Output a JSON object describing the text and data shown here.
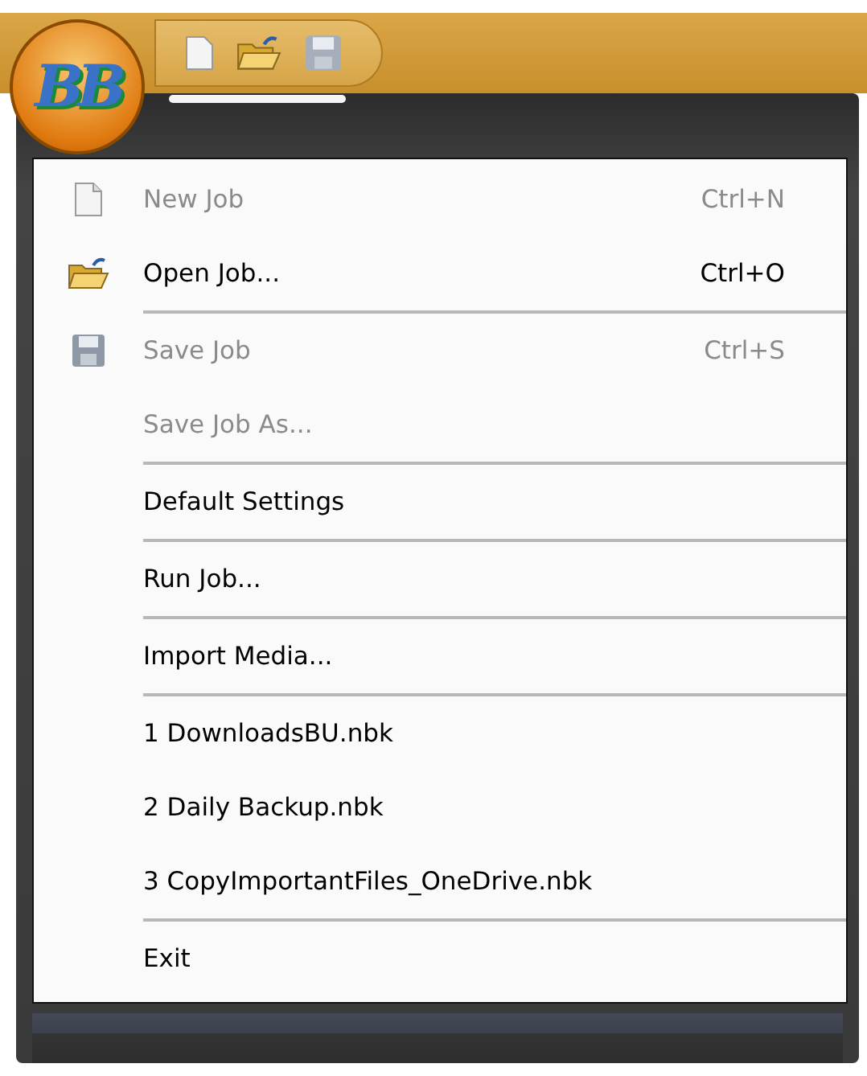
{
  "app_button": {
    "logo_text": "BB"
  },
  "menu": {
    "items": [
      {
        "label": "New Job",
        "shortcut": "Ctrl+N",
        "disabled": true,
        "separator_after": false
      },
      {
        "label": "Open Job...",
        "shortcut": "Ctrl+O",
        "disabled": false,
        "separator_after": true
      },
      {
        "label": "Save Job",
        "shortcut": "Ctrl+S",
        "disabled": true,
        "separator_after": false
      },
      {
        "label": "Save Job As...",
        "disabled": true,
        "separator_after": true
      },
      {
        "label": "Default Settings",
        "disabled": false,
        "separator_after": true
      },
      {
        "label": "Run Job...",
        "disabled": false,
        "separator_after": true
      },
      {
        "label": "Import Media...",
        "disabled": false,
        "separator_after": true
      },
      {
        "label": "1 DownloadsBU.nbk",
        "disabled": false,
        "separator_after": false
      },
      {
        "label": "2 Daily Backup.nbk",
        "disabled": false,
        "separator_after": false
      },
      {
        "label": "3 CopyImportantFiles_OneDrive.nbk",
        "disabled": false,
        "separator_after": true
      },
      {
        "label": "Exit",
        "disabled": false,
        "separator_after": false
      }
    ]
  }
}
